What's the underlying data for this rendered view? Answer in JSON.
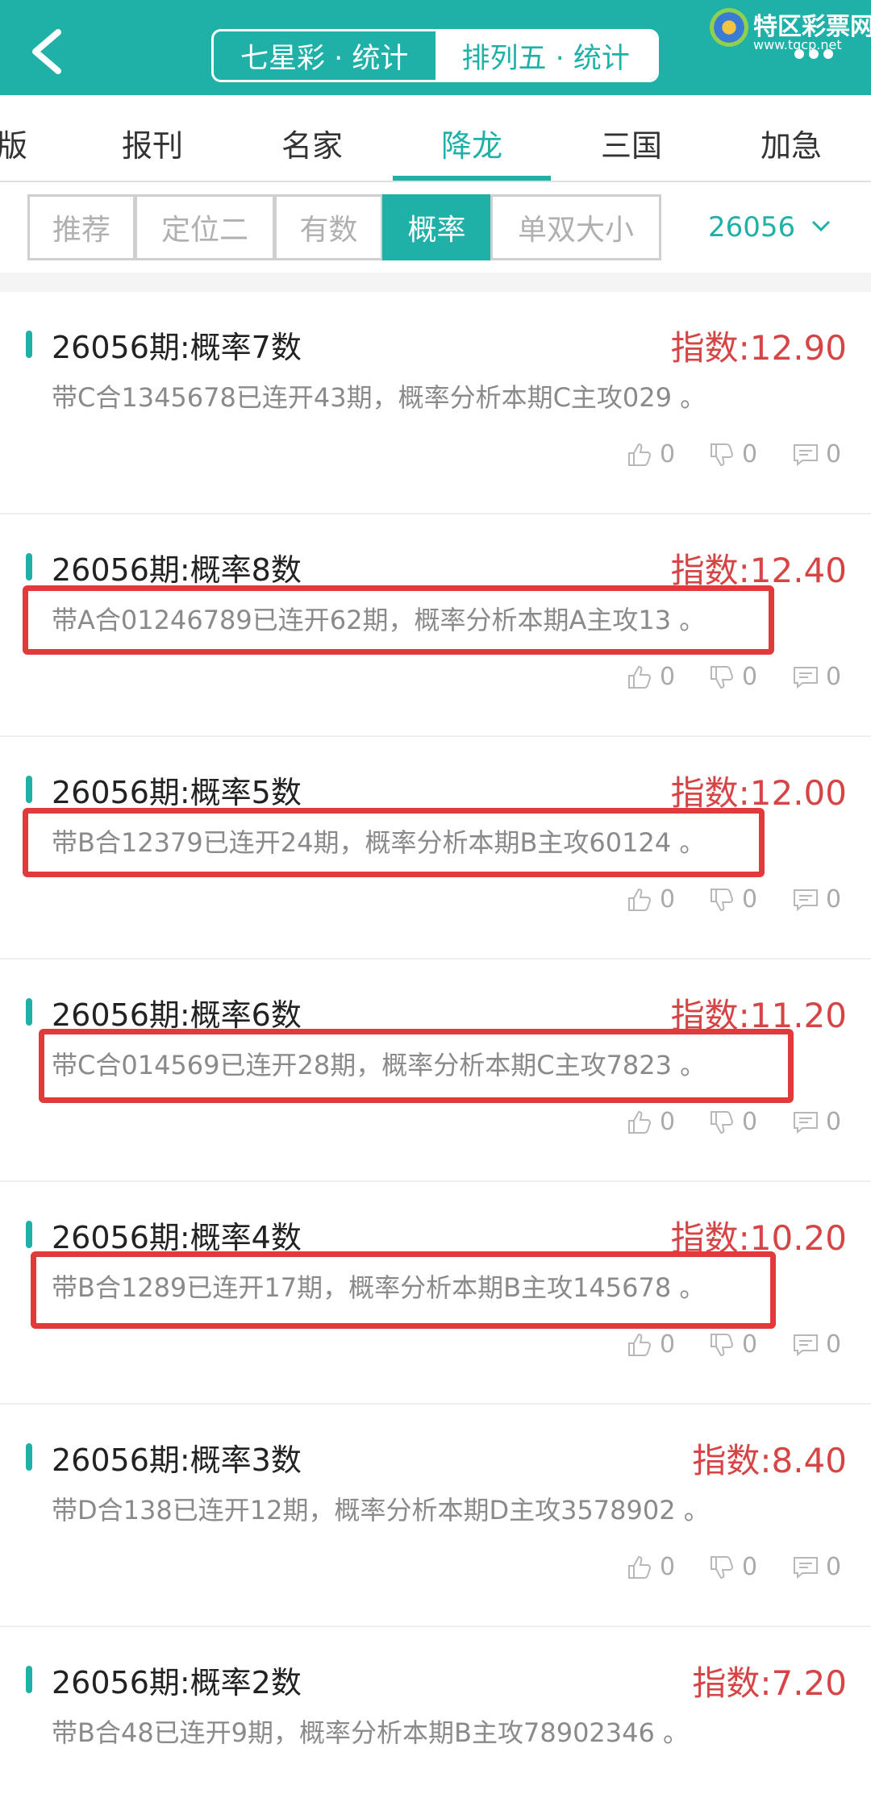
{
  "header": {
    "seg_tabs": [
      "七星彩 · 统计",
      "排列五 · 统计"
    ],
    "logo_name": "特区彩票网",
    "logo_url": "www.tqcp.net"
  },
  "tabs": [
    "版",
    "报刊",
    "名家",
    "降龙",
    "三国",
    "加急"
  ],
  "filters": [
    "推荐",
    "定位二",
    "有数",
    "概率",
    "单双大小"
  ],
  "period_select": "26056",
  "items": [
    {
      "title": "26056期:概率7数",
      "index": "指数:12.90",
      "desc": "带C合1345678已连开43期，概率分析本期C主攻029 。",
      "likes": "0",
      "dislikes": "0",
      "comments": "0"
    },
    {
      "title": "26056期:概率8数",
      "index": "指数:12.40",
      "desc": "带A合01246789已连开62期，概率分析本期A主攻13 。",
      "likes": "0",
      "dislikes": "0",
      "comments": "0"
    },
    {
      "title": "26056期:概率5数",
      "index": "指数:12.00",
      "desc": "带B合12379已连开24期，概率分析本期B主攻60124 。",
      "likes": "0",
      "dislikes": "0",
      "comments": "0"
    },
    {
      "title": "26056期:概率6数",
      "index": "指数:11.20",
      "desc": "带C合014569已连开28期，概率分析本期C主攻7823 。",
      "likes": "0",
      "dislikes": "0",
      "comments": "0"
    },
    {
      "title": "26056期:概率4数",
      "index": "指数:10.20",
      "desc": "带B合1289已连开17期，概率分析本期B主攻145678 。",
      "likes": "0",
      "dislikes": "0",
      "comments": "0"
    },
    {
      "title": "26056期:概率3数",
      "index": "指数:8.40",
      "desc": "带D合138已连开12期，概率分析本期D主攻3578902 。",
      "likes": "0",
      "dislikes": "0",
      "comments": "0"
    },
    {
      "title": "26056期:概率2数",
      "index": "指数:7.20",
      "desc": "带B合48已连开9期，概率分析本期B主攻78902346 。"
    }
  ],
  "colors": {
    "accent": "#1fb0a8",
    "index_red": "#d64545",
    "highlight": "#e23a3a"
  }
}
